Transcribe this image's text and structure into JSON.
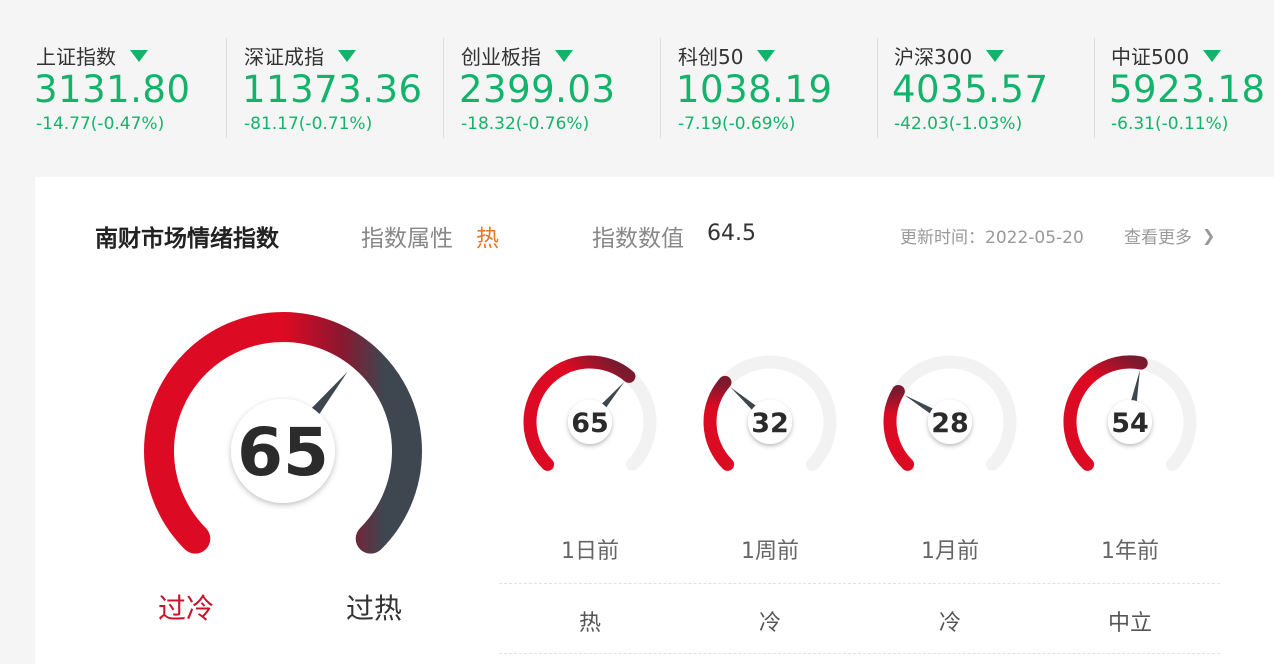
{
  "indices": [
    {
      "name": "上证指数",
      "value": "3131.80",
      "change": "-14.77(-0.47%)"
    },
    {
      "name": "深证成指",
      "value": "11373.36",
      "change": "-81.17(-0.71%)"
    },
    {
      "name": "创业板指",
      "value": "2399.03",
      "change": "-18.32(-0.76%)"
    },
    {
      "name": "科创50",
      "value": "1038.19",
      "change": "-7.19(-0.69%)"
    },
    {
      "name": "沪深300",
      "value": "4035.57",
      "change": "-42.03(-1.03%)"
    },
    {
      "name": "中证500",
      "value": "5923.18",
      "change": "-6.31(-0.11%)"
    }
  ],
  "panel": {
    "title": "南财市场情绪指数",
    "attr_label": "指数属性",
    "attr_value": "热",
    "num_label": "指数数值",
    "num_value": "64.5",
    "update_time": "更新时间：2022-05-20",
    "see_more": "查看更多",
    "gauge_value": "65",
    "gauge_fraction": 0.645,
    "cold_label": "过冷",
    "hot_label": "过热"
  },
  "history": [
    {
      "period": "1日前",
      "value": "65",
      "fraction": 0.65,
      "mood": "热"
    },
    {
      "period": "1周前",
      "value": "32",
      "fraction": 0.32,
      "mood": "冷"
    },
    {
      "period": "1月前",
      "value": "28",
      "fraction": 0.28,
      "mood": "冷"
    },
    {
      "period": "1年前",
      "value": "54",
      "fraction": 0.54,
      "mood": "中立"
    }
  ],
  "colors": {
    "down": "#14b36b",
    "hot": "#e8772e",
    "gauge_red": "#dc0a22",
    "gauge_dark": "#3e4650",
    "track": "#f2f2f2"
  }
}
